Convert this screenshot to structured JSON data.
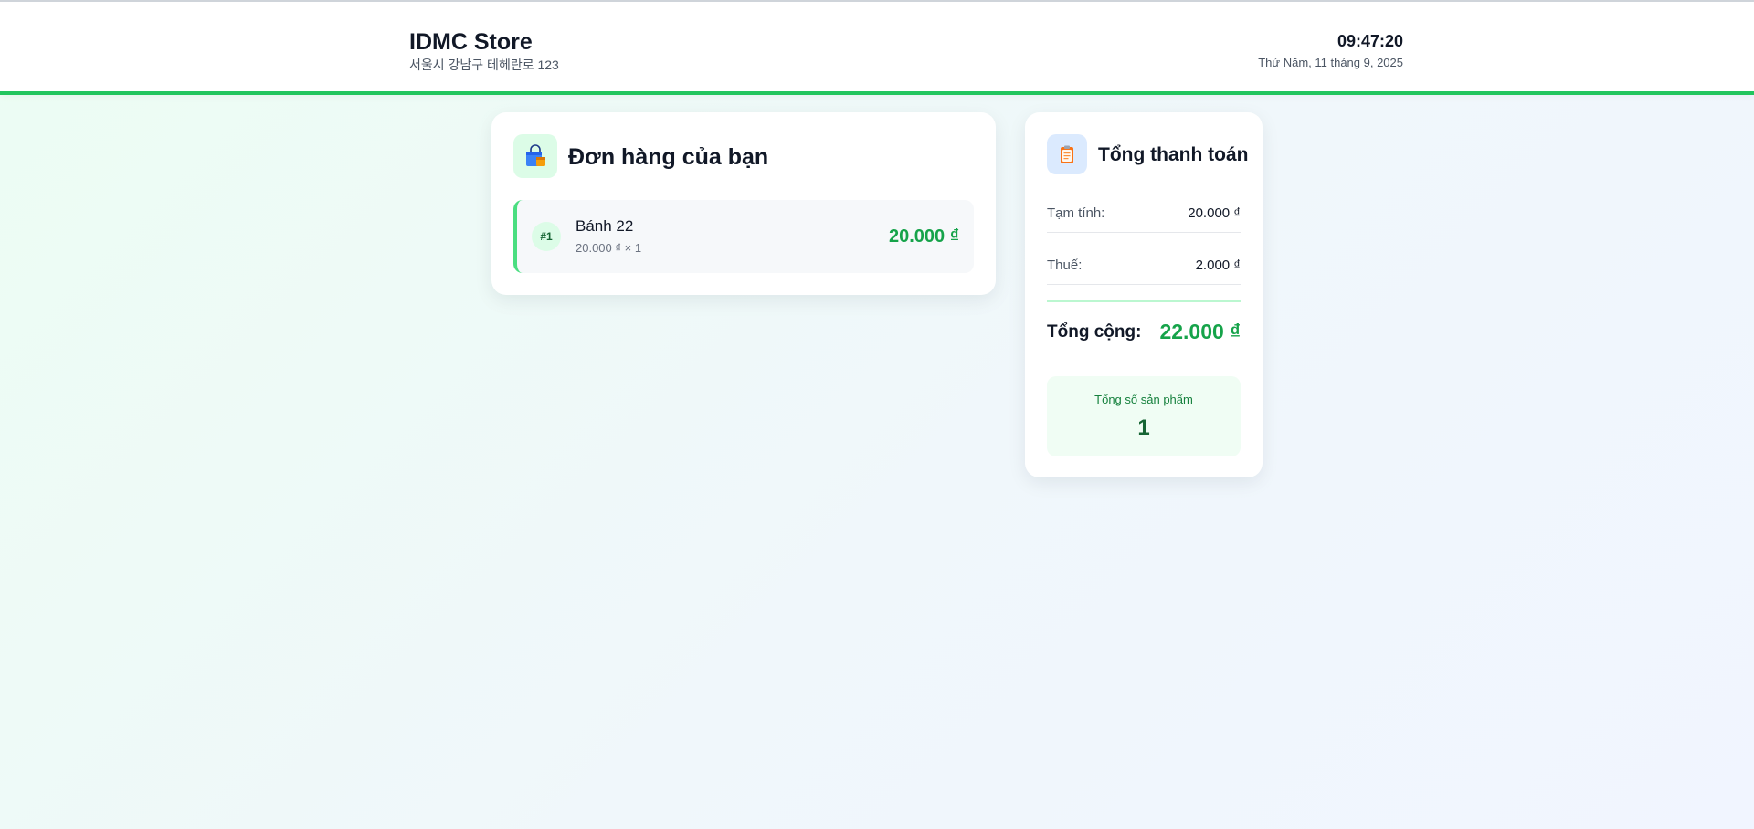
{
  "header": {
    "store_name": "IDMC Store",
    "store_address": "서울시 강남구 테헤란로 123",
    "time": "09:47:20",
    "date": "Thứ Năm, 11 tháng 9, 2025"
  },
  "order": {
    "title": "Đơn hàng của bạn",
    "icon": "shopping-bag-icon",
    "items": [
      {
        "index": "#1",
        "name": "Bánh 22",
        "detail": "20.000 ₫ × 1",
        "price": "20.000 ₫"
      }
    ]
  },
  "summary": {
    "title": "Tổng thanh toán",
    "icon": "clipboard-icon",
    "subtotal_label": "Tạm tính:",
    "subtotal_value": "20.000 ₫",
    "tax_label": "Thuế:",
    "tax_value": "2.000 ₫",
    "total_label": "Tổng cộng:",
    "total_value": "22.000 ₫",
    "count_label": "Tổng số sản phẩm",
    "count_value": "1"
  },
  "colors": {
    "accent_green": "#22c55e",
    "price_green": "#16a34a"
  }
}
